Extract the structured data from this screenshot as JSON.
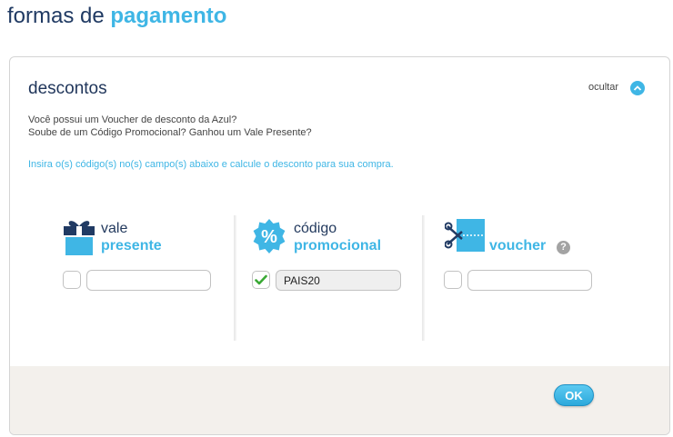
{
  "page": {
    "title_prefix": "formas de",
    "title_accent": "pagamento"
  },
  "panel": {
    "title": "descontos",
    "hide_label": "ocultar",
    "hide_icon": "chevron-up-icon",
    "intro_line1": "Você possui um Voucher de desconto da Azul?",
    "intro_line2": "Soube de um Código Promocional? Ganhou um Vale Presente?",
    "instruction": "Insira o(s) código(s) no(s) campo(s) abaixo e calcule o desconto para sua compra."
  },
  "options": [
    {
      "icon": "gift-icon",
      "line1": "vale",
      "line2": "presente",
      "checked": false,
      "value": ""
    },
    {
      "icon": "percent-badge-icon",
      "line1": "código",
      "line2": "promocional",
      "checked": true,
      "value": "PAIS20"
    },
    {
      "icon": "scissors-icon",
      "line1": "",
      "line2": "voucher",
      "checked": false,
      "value": "",
      "help": "?"
    }
  ],
  "footer": {
    "ok_label": "OK"
  },
  "colors": {
    "navy": "#203a63",
    "accent": "#3fb6e5",
    "footer_bg": "#f3f0ec",
    "check_green": "#3aa935"
  }
}
